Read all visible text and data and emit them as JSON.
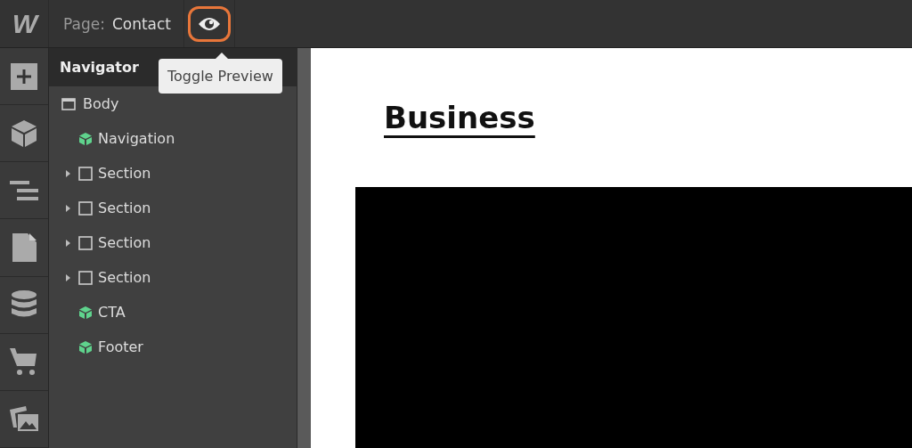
{
  "topbar": {
    "logo": "W",
    "page_label": "Page:",
    "page_name": "Contact",
    "preview_button": {
      "active": true
    }
  },
  "tooltip": {
    "text": "Toggle Preview"
  },
  "rail": [
    {
      "kind": "add"
    },
    {
      "kind": "box"
    },
    {
      "kind": "navigator"
    },
    {
      "kind": "page"
    },
    {
      "kind": "database"
    },
    {
      "kind": "cart"
    },
    {
      "kind": "images"
    }
  ],
  "navigator": {
    "title": "Navigator",
    "tree": [
      {
        "label": "Body",
        "kind": "body",
        "children": [
          {
            "label": "Navigation",
            "kind": "component"
          },
          {
            "label": "Section",
            "kind": "section",
            "expanded": false
          },
          {
            "label": "Section",
            "kind": "section",
            "expanded": false
          },
          {
            "label": "Section",
            "kind": "section",
            "expanded": false
          },
          {
            "label": "Section",
            "kind": "section",
            "expanded": false
          },
          {
            "label": "CTA",
            "kind": "component"
          },
          {
            "label": "Footer",
            "kind": "component"
          }
        ]
      }
    ]
  },
  "canvas": {
    "heading": "Business"
  }
}
